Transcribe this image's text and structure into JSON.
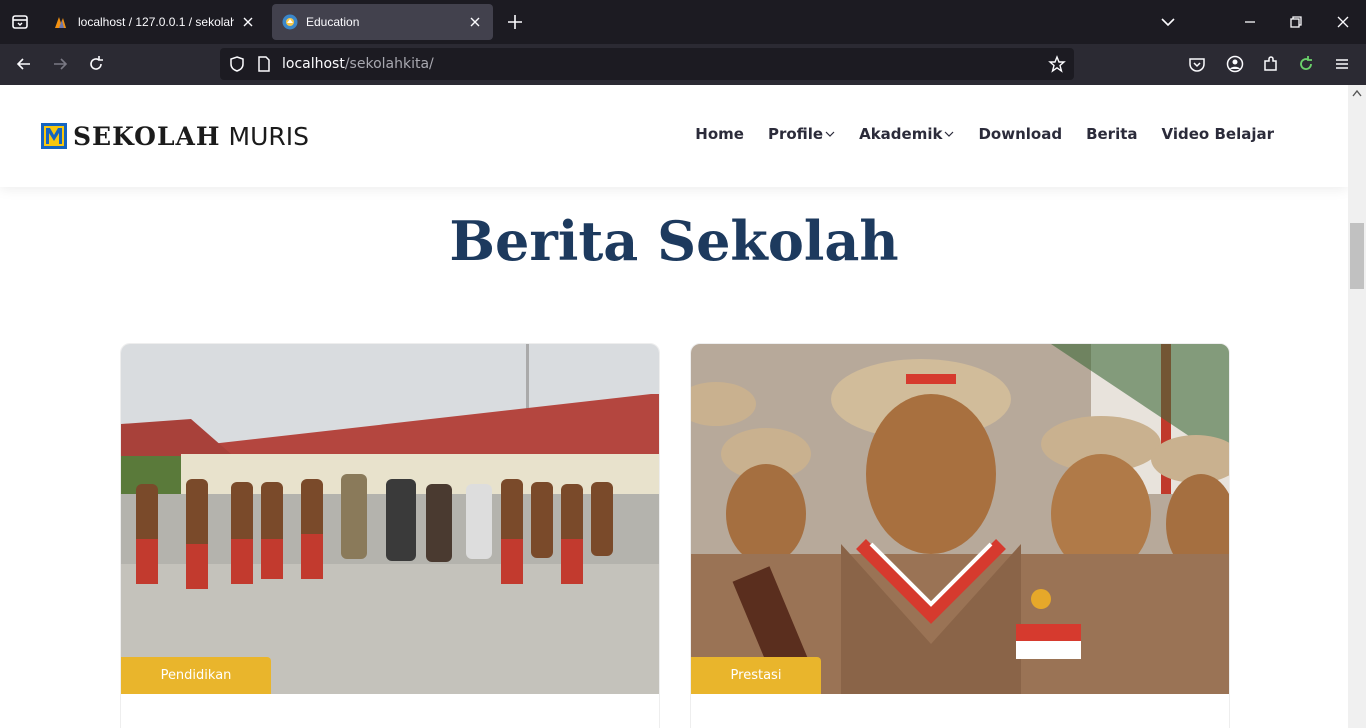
{
  "browser": {
    "tabs": [
      {
        "title": "localhost / 127.0.0.1 / sekolah | ...",
        "active": false
      },
      {
        "title": "Education",
        "active": true
      }
    ],
    "url_host": "localhost",
    "url_path": "/sekolahkita/"
  },
  "site": {
    "logo_bold": "SEKOLAH",
    "logo_thin": "MURIS",
    "menu": [
      {
        "label": "Home",
        "dropdown": false
      },
      {
        "label": "Profile",
        "dropdown": true
      },
      {
        "label": "Akademik",
        "dropdown": true
      },
      {
        "label": "Download",
        "dropdown": false
      },
      {
        "label": "Berita",
        "dropdown": false
      },
      {
        "label": "Video Belajar",
        "dropdown": false
      }
    ]
  },
  "section": {
    "title": "Berita Sekolah"
  },
  "cards": [
    {
      "category": "Pendidikan"
    },
    {
      "category": "Prestasi"
    }
  ],
  "colors": {
    "accent": "#e9b52c",
    "title": "#1d3a5e",
    "logo_blue": "#1565c0",
    "logo_yellow": "#f9c80e"
  }
}
